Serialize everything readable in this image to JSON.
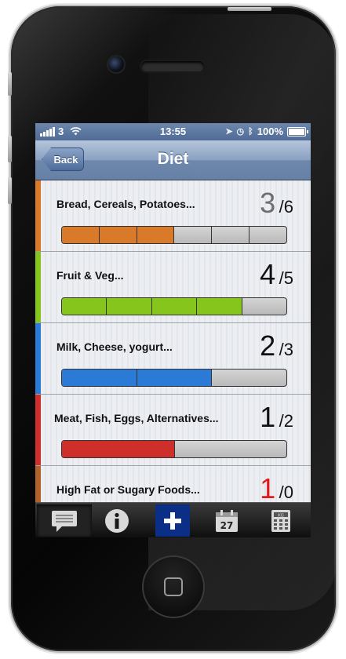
{
  "status_bar": {
    "carrier": "3",
    "time": "13:55",
    "battery": "100%"
  },
  "nav": {
    "title": "Diet",
    "back_label": "Back"
  },
  "rows": [
    {
      "label": "Bread, Cereals, Potatoes...",
      "score": "3",
      "target": "/6",
      "color": "#d97a2a",
      "score_color": "#6e6e6e",
      "filled": 3,
      "total": 6
    },
    {
      "label": "Fruit & Veg...",
      "score": "4",
      "target": "/5",
      "color": "#86c61c",
      "score_color": "#111111",
      "filled": 4,
      "total": 5
    },
    {
      "label": "Milk, Cheese, yogurt...",
      "score": "2",
      "target": "/3",
      "color": "#2b7ad6",
      "score_color": "#111111",
      "filled": 2,
      "total": 3
    },
    {
      "label": "Meat, Fish, Eggs, Alternatives...",
      "score": "1",
      "target": "/2",
      "color": "#cf2f2b",
      "score_color": "#111111",
      "filled": 1,
      "total": 2
    },
    {
      "label": "High Fat or Sugary Foods...",
      "score": "1",
      "target": "/0",
      "color": "#b0622a",
      "score_color": "#e01b1b",
      "filled": 0,
      "total": 0
    }
  ],
  "tabs": {
    "calendar_day": "27",
    "scale_label": "KG"
  },
  "colors": {
    "navbar": "#7a93b6",
    "tab_selected": "#0b2e87"
  }
}
